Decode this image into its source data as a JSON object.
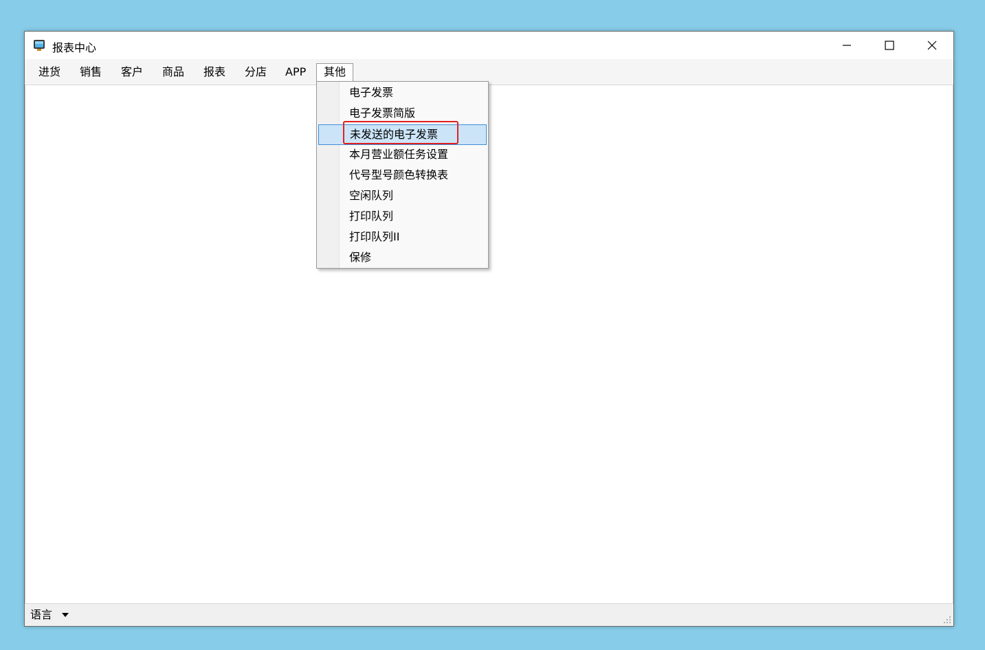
{
  "window": {
    "title": "报表中心",
    "icon": "app-monitor-icon",
    "controls": {
      "minimize": "minimize-icon",
      "maximize": "maximize-icon",
      "close": "close-icon"
    }
  },
  "menubar": {
    "items": [
      {
        "label": "进货"
      },
      {
        "label": "销售"
      },
      {
        "label": "客户"
      },
      {
        "label": "商品"
      },
      {
        "label": "报表"
      },
      {
        "label": "分店"
      },
      {
        "label": "APP"
      },
      {
        "label": "其他"
      }
    ],
    "active": "其他"
  },
  "dropdown": {
    "items": [
      {
        "label": "电子发票"
      },
      {
        "label": "电子发票简版"
      },
      {
        "label": "未发送的电子发票"
      },
      {
        "label": "本月营业额任务设置"
      },
      {
        "label": "代号型号颜色转换表"
      },
      {
        "label": "空闲队列"
      },
      {
        "label": "打印队列"
      },
      {
        "label": "打印队列II"
      },
      {
        "label": "保修"
      }
    ],
    "highlighted": "未发送的电子发票"
  },
  "statusbar": {
    "language_label": "语言"
  },
  "colors": {
    "desktop": "#87cde9",
    "highlight_bg": "#cce4f7",
    "highlight_border": "#3d8ed8",
    "annotation_box": "#e0201f"
  }
}
